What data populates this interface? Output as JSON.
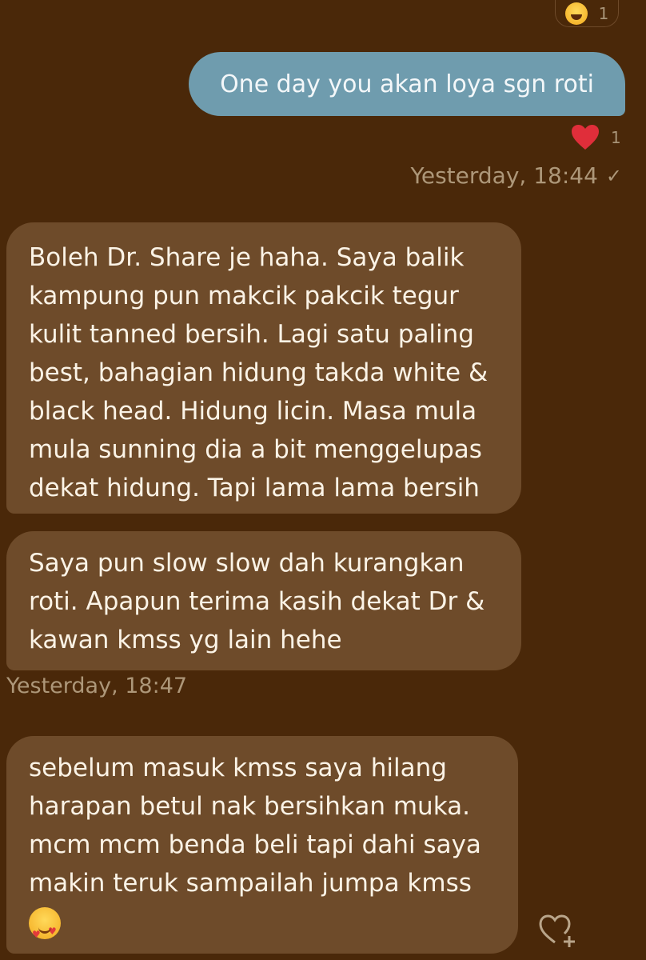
{
  "top_reaction": {
    "count": "1",
    "emoji": "laughing-face-icon"
  },
  "outgoing": {
    "text": "One day you akan loya sgn roti",
    "reaction_count": "1",
    "time": "Yesterday, 18:44",
    "status": "✓"
  },
  "incoming": [
    {
      "text": "Boleh Dr. Share je haha. Saya balik kampung pun makcik pakcik tegur kulit tanned bersih. Lagi satu paling best, bahagian hidung takda white & black head. Hidung licin. Masa mula mula sunning dia a bit menggelupas dekat hidung. Tapi lama lama bersih"
    },
    {
      "text": "Saya pun slow slow dah kurangkan roti. Apapun terima kasih dekat Dr & kawan kmss yg lain hehe"
    },
    {
      "text": "sebelum masuk kmss saya hilang harapan betul nak bersihkan muka. mcm mcm benda beli tapi dahi saya makin teruk sampailah jumpa kmss"
    }
  ],
  "incoming_time": "Yesterday, 18:47",
  "colors": {
    "background": "#4a2809",
    "outgoing_bubble": "#6f9cae",
    "incoming_bubble": "#6e4b2a",
    "heart": "#e02e3a"
  }
}
